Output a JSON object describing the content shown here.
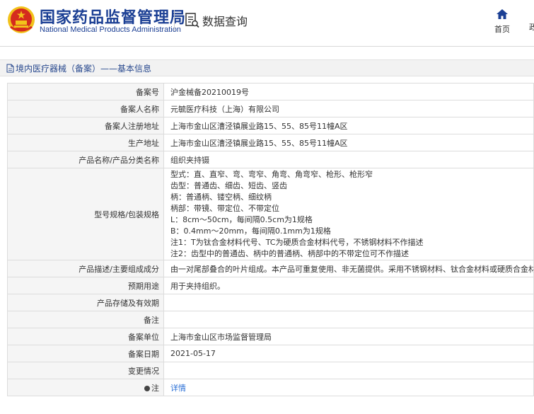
{
  "header": {
    "title_cn": "国家药品监督管理局",
    "title_en": "National Medical Products Administration",
    "query_label": "数据查询",
    "nav_home": "首页",
    "nav_cut": "政"
  },
  "breadcrumb": {
    "text": "境内医疗器械（备案）——基本信息"
  },
  "rows": [
    {
      "label": "备案号",
      "value": "沪金械备20210019号"
    },
    {
      "label": "备案人名称",
      "value": "元毓医疗科技（上海）有限公司"
    },
    {
      "label": "备案人注册地址",
      "value": "上海市金山区漕泾镇展业路15、55、85号11幢A区"
    },
    {
      "label": "生产地址",
      "value": "上海市金山区漕泾镇展业路15、55、85号11幢A区"
    },
    {
      "label": "产品名称/产品分类名称",
      "value": "组织夹持镊"
    },
    {
      "label": "型号规格/包装规格",
      "lines": [
        "型式：直、直窄、弯、弯窄、角弯、角弯窄、枪形、枪形窄",
        "齿型：普通齿、细齿、短齿、竖齿",
        "柄：普通柄、镂空柄、细纹柄",
        "柄部：带镜、带定位、不带定位",
        "L：8cm～50cm，每间隔0.5cm为1规格",
        "B：0.4mm～20mm，每间隔0.1mm为1规格",
        "注1：T为钛合金材料代号、TC为硬质合金材料代号，不锈钢材料不作描述",
        "注2：齿型中的普通齿、柄中的普通柄、柄部中的不带定位可不作描述"
      ]
    },
    {
      "label": "产品描述/主要组成成分",
      "value": "由一对尾部叠合的叶片组成。本产品可重复使用、非无菌提供。采用不锈钢材料、钛合金材料或硬质合金材料制成。"
    },
    {
      "label": "预期用途",
      "value": "用于夹持组织。"
    },
    {
      "label": "产品存储及有效期",
      "value": ""
    },
    {
      "label": "备注",
      "value": ""
    },
    {
      "label": "备案单位",
      "value": "上海市金山区市场监督管理局"
    },
    {
      "label": "备案日期",
      "value": "2021-05-17"
    },
    {
      "label": "变更情况",
      "value": ""
    },
    {
      "label": "注",
      "value": "详情"
    }
  ],
  "colors": {
    "brand": "#1b3f94",
    "emblem_red": "#d52b1e",
    "emblem_gold": "#f2c21b",
    "link": "#2a6fd6"
  },
  "icons": [
    "national-emblem-icon",
    "data-query-icon",
    "home-icon",
    "document-icon",
    "pin-icon"
  ]
}
